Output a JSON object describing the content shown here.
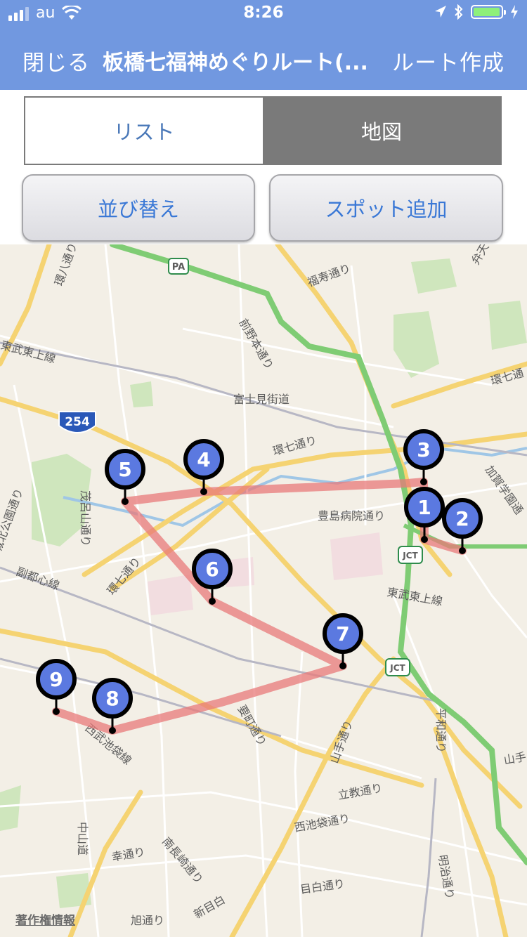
{
  "status_bar": {
    "carrier": "au",
    "time": "8:26",
    "battery_color": "#8ef07a"
  },
  "nav": {
    "close_label": "閉じる",
    "title": "板橋七福神めぐりルート(...",
    "create_route_label": "ルート作成"
  },
  "segment": {
    "list_label": "リスト",
    "map_label": "地図",
    "selected": "地図"
  },
  "actions": {
    "sort_label": "並び替え",
    "add_spot_label": "スポット追加"
  },
  "map": {
    "copyright_label": "著作権情報",
    "route_color": "#e87a7a",
    "pin_color": "#5b79e0",
    "expressway_color": "#7fcc74",
    "shields": {
      "pa": "PA",
      "route_254": "254",
      "jct_1": "JCT",
      "jct_2": "JCT"
    },
    "labels": {
      "kanpachi": "環八通り",
      "fukuju": "福寿通り",
      "benten": "弁天",
      "maeno": "前野本通り",
      "tobu_tojo_1": "東武東上線",
      "fujimi": "富士見街道",
      "kannana_1": "環七通り",
      "kannana_2": "環七通",
      "kannana_3": "環七通り",
      "kaga": "加賀学園通",
      "jonan": "城北公園通り",
      "moroyama": "茂呂山通り",
      "toshima": "豊島病院通り",
      "tobu_tojo_2": "東武東上線",
      "fukutoshin": "副都心線",
      "kanname": "要町通り",
      "yamate": "山手通り",
      "heiwa": "平和通り",
      "seibu": "西武池袋線",
      "rikkyo": "立教通り",
      "nishiikebukuro": "西池袋通り",
      "nakasendo": "中山道",
      "saiwai": "幸通り",
      "minaminaga": "南長崎通り",
      "meiji": "明治通り",
      "mejiro": "目白通り",
      "asahi": "旭通り",
      "shinmejiro": "新目白",
      "yamate_right": "山手"
    },
    "pins": [
      {
        "number": "1"
      },
      {
        "number": "2"
      },
      {
        "number": "3"
      },
      {
        "number": "4"
      },
      {
        "number": "5"
      },
      {
        "number": "6"
      },
      {
        "number": "7"
      },
      {
        "number": "8"
      },
      {
        "number": "9"
      }
    ]
  }
}
